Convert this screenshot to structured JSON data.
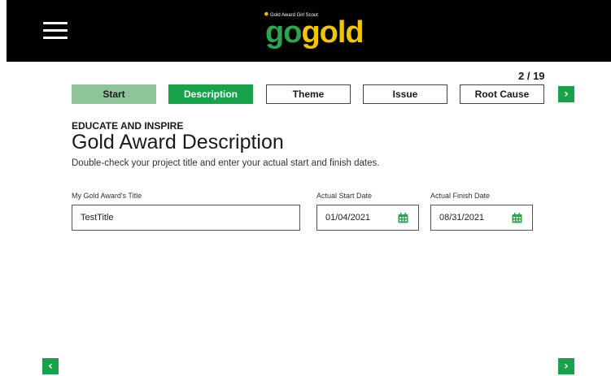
{
  "header": {
    "logo_tagline": "Gold Award Girl Scout",
    "logo_go": "go",
    "logo_gold": "gold"
  },
  "progress": {
    "counter": "2 / 19"
  },
  "tabs": [
    {
      "label": "Start",
      "state": "done"
    },
    {
      "label": "Description",
      "state": "active"
    },
    {
      "label": "Theme",
      "state": "pending"
    },
    {
      "label": "Issue",
      "state": "pending"
    },
    {
      "label": "Root Cause",
      "state": "pending"
    }
  ],
  "section": {
    "eyebrow": "EDUCATE AND INSPIRE",
    "title": "Gold Award Description",
    "subtitle": "Double-check your project title and enter your actual start and finish dates."
  },
  "form": {
    "title_label": "My Gold Award's Title",
    "title_value": "TestTitle",
    "start_label": "Actual Start Date",
    "start_value": "01/04/2021",
    "finish_label": "Actual Finish Date",
    "finish_value": "08/31/2021"
  },
  "nav": {
    "prev": "‹",
    "next": "›"
  },
  "colors": {
    "accent": "#17a34a",
    "done": "#8fc49b",
    "gold": "#f3c400"
  }
}
